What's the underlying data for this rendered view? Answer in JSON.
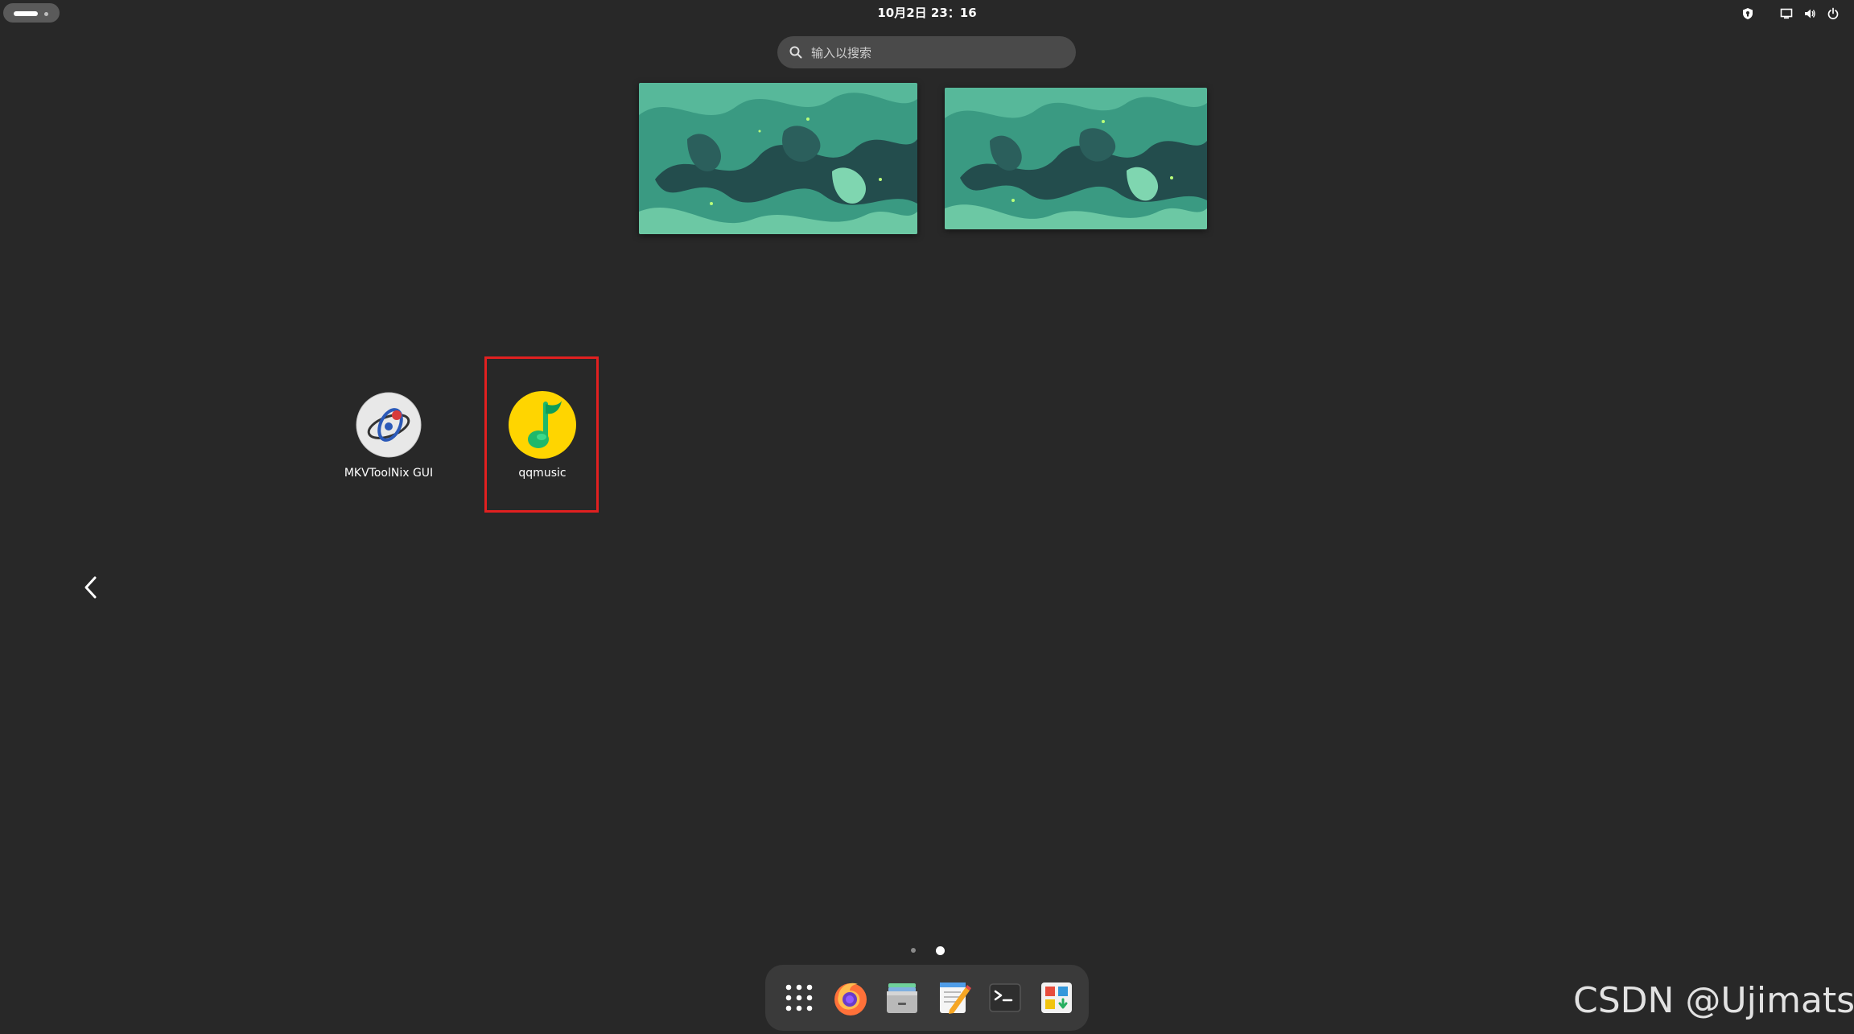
{
  "topbar": {
    "clock": "10月2日  23：16",
    "tray_icons": [
      "shield-icon",
      "display-icon",
      "volume-icon",
      "power-icon"
    ]
  },
  "search": {
    "placeholder": "输入以搜索",
    "value": ""
  },
  "workspaces": [
    {
      "name": "workspace-1-thumbnail"
    },
    {
      "name": "workspace-2-thumbnail"
    }
  ],
  "apps": [
    {
      "label": "MKVToolNix GUI",
      "icon": "mkvtoolnix-icon"
    },
    {
      "label": "qqmusic",
      "icon": "qqmusic-icon",
      "highlighted": true
    }
  ],
  "pagination": {
    "pages": 2,
    "current": 2
  },
  "dock": {
    "items": [
      "app-grid-icon",
      "firefox-icon",
      "file-manager-icon",
      "text-editor-icon",
      "terminal-icon",
      "software-center-icon"
    ]
  },
  "watermark": "CSDN @Ujimatsu",
  "colors": {
    "background": "#282828",
    "highlight": "#e12020",
    "wallpaper_accent": "#3aa88a"
  }
}
